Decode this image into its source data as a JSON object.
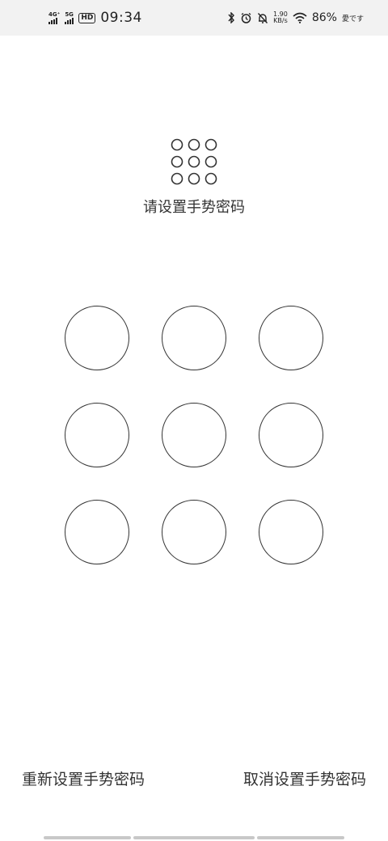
{
  "status_bar": {
    "net1": "4G⁺",
    "net2": "5G",
    "hd": "HD",
    "time": "09:34",
    "speed_value": "1.90",
    "speed_unit": "KB/s",
    "battery": "86%",
    "carrier": "愛です",
    "icons": [
      "bluetooth-icon",
      "alarm-icon",
      "mute-bell-icon",
      "wifi-icon"
    ]
  },
  "header": {
    "icon": "pattern-grid-icon",
    "prompt": "请设置手势密码"
  },
  "pattern": {
    "nodes": [
      1,
      2,
      3,
      4,
      5,
      6,
      7,
      8,
      9
    ]
  },
  "footer": {
    "reset_label": "重新设置手势密码",
    "cancel_label": "取消设置手势密码"
  },
  "colors": {
    "stroke": "#333333",
    "background": "#ffffff",
    "status_bg": "#f2f2f2"
  }
}
